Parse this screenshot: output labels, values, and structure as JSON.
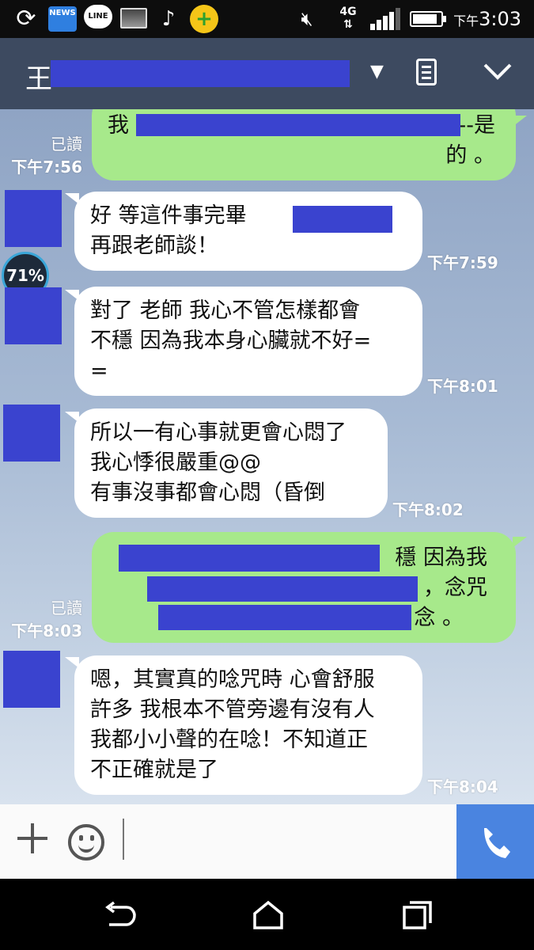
{
  "status_bar": {
    "news_label": "NEWS",
    "line_label": "LINE",
    "network": "4G",
    "time_prefix": "下午",
    "time": "3:03",
    "icons": [
      "sync-icon",
      "news-icon",
      "line-icon",
      "image-icon",
      "music-icon",
      "plus-app-icon",
      "mute-icon",
      "signal-icon",
      "battery-icon"
    ]
  },
  "header": {
    "title_visible": "王"
  },
  "floating_badge": "71%",
  "messages": [
    {
      "side": "out",
      "text": "我",
      "text2": "--是\n的 。",
      "read": "已讀",
      "time": "下午7:56"
    },
    {
      "side": "in",
      "text": "好 等這件事完畢 \n再跟老師談！",
      "time": "下午7:59"
    },
    {
      "side": "in",
      "text": "對了 老師 我心不管怎樣都會\n不穩 因為我本身心臟就不好=\n=",
      "time": "下午8:01"
    },
    {
      "side": "in",
      "text": "所以一有心事就更會心悶了\n我心悸很嚴重@@\n有事沒事都會心悶（昏倒",
      "time": "下午8:02"
    },
    {
      "side": "out",
      "text": "穩 因為我",
      "text2": "，念咒",
      "text3": "念 。",
      "read": "已讀",
      "time": "下午8:03"
    },
    {
      "side": "in",
      "text": "嗯，其實真的唸咒時 心會舒服\n許多 我根本不管旁邊有沒有人\n我都小小聲的在唸！不知道正\n不正確就是了",
      "time": "下午8:04"
    }
  ],
  "colors": {
    "incoming_bubble": "#ffffff",
    "outgoing_bubble": "#a7e98b",
    "header": "#3d4a60",
    "redaction": "#3a43cf",
    "call_button": "#4a84e0"
  }
}
